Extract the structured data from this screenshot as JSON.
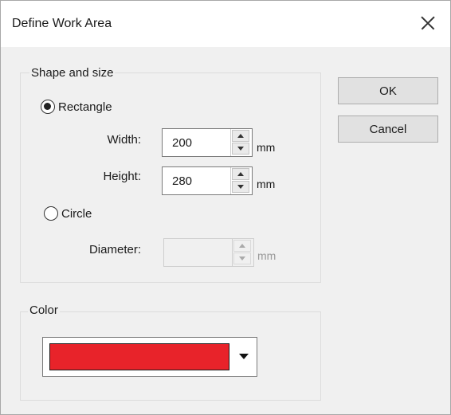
{
  "window": {
    "title": "Define Work Area"
  },
  "shape_group": {
    "title": "Shape and size",
    "rectangle": {
      "label": "Rectangle",
      "checked": true
    },
    "width": {
      "label": "Width:",
      "value": "200",
      "unit": "mm"
    },
    "height": {
      "label": "Height:",
      "value": "280",
      "unit": "mm"
    },
    "circle": {
      "label": "Circle",
      "checked": false
    },
    "diameter": {
      "label": "Diameter:",
      "value": "",
      "unit": "mm",
      "enabled": false
    }
  },
  "color_group": {
    "title": "Color",
    "selected_color": "#e8232a"
  },
  "buttons": {
    "ok": "OK",
    "cancel": "Cancel"
  },
  "icons": {
    "close": "close-icon",
    "spin_up": "spin-up-icon",
    "spin_down": "spin-down-icon",
    "dropdown": "chevron-down-icon"
  }
}
